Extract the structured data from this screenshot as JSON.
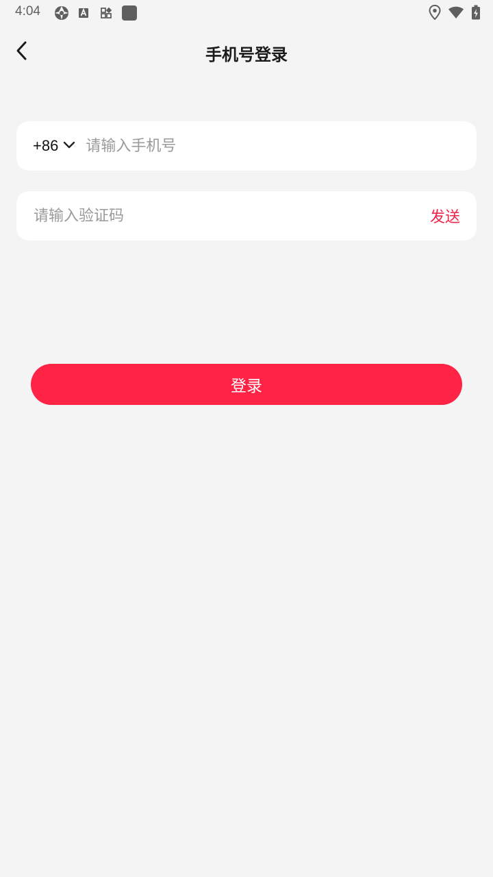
{
  "status_bar": {
    "time": "4:04",
    "icons_left": [
      "aperture-icon",
      "translate-a-icon",
      "widgets-icon",
      "app-square-icon"
    ],
    "icons_right": [
      "location-pin-icon",
      "wifi-icon",
      "battery-charging-icon"
    ],
    "icon_color": "#5f5f5f"
  },
  "header": {
    "title": "手机号登录",
    "back_icon": "chevron-left-icon"
  },
  "phone_field": {
    "country_code": "+86",
    "dropdown_icon": "chevron-down-icon",
    "value": "",
    "placeholder": "请输入手机号"
  },
  "code_field": {
    "value": "",
    "placeholder": "请输入验证码",
    "send_label": "发送"
  },
  "login_button": {
    "label": "登录"
  },
  "colors": {
    "background": "#f4f4f4",
    "card": "#ffffff",
    "accent": "#ff2345",
    "send_text": "#f0244a",
    "placeholder": "#9a9a9a"
  }
}
